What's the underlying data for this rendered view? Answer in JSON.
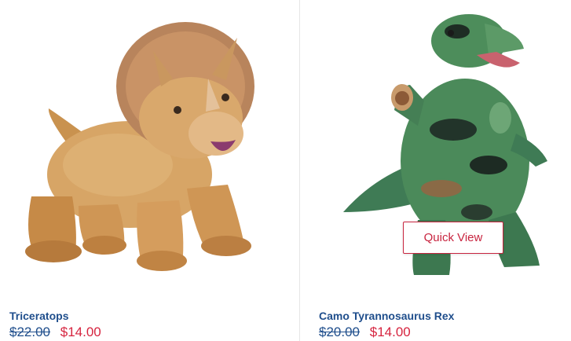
{
  "products": [
    {
      "name": "Triceratops",
      "price_original": "$22.00",
      "price_sale": "$14.00",
      "image_icon": "triceratops-plush-image"
    },
    {
      "name": "Camo Tyrannosaurus Rex",
      "price_original": "$20.00",
      "price_sale": "$14.00",
      "image_icon": "camo-trex-plush-image",
      "quick_view_label": "Quick View"
    }
  ],
  "colors": {
    "name_blue": "#1f4e8c",
    "sale_red": "#d6243f"
  }
}
